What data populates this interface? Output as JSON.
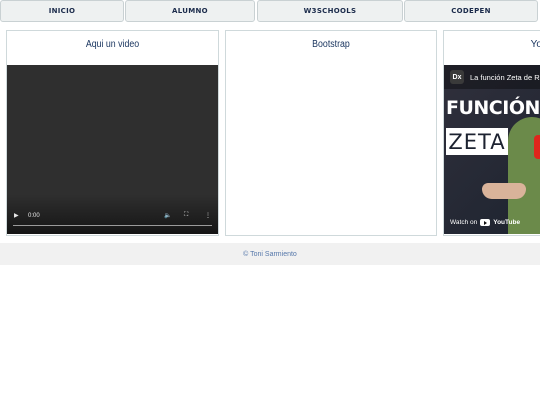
{
  "nav": {
    "items": [
      {
        "label": "INICIO"
      },
      {
        "label": "ALUMNO"
      },
      {
        "label": "W3SCHOOLS"
      },
      {
        "label": "CODEPEN"
      }
    ]
  },
  "cards": {
    "video": {
      "title": "Aqui un video",
      "time": "0:00",
      "volume_icon": "volume-icon",
      "fullscreen_icon": "fullscreen-icon",
      "menu_icon": "more-options-icon"
    },
    "bootstrap": {
      "title": "Bootstrap"
    },
    "youtube": {
      "title": "Yo",
      "video_title": "La función Zeta de R",
      "logo": "Dx",
      "big_line1": "FUNCIÓN",
      "big_line2": "ZETA",
      "watch_on": "Watch on",
      "yt_brand": "YouTube"
    }
  },
  "footer": {
    "text": "© Toni Sarmiento"
  },
  "colors": {
    "nav_bg": "#eef1f1",
    "nav_text": "#1b2b4b",
    "card_title": "#1b3660",
    "footer_text": "#5577aa"
  }
}
